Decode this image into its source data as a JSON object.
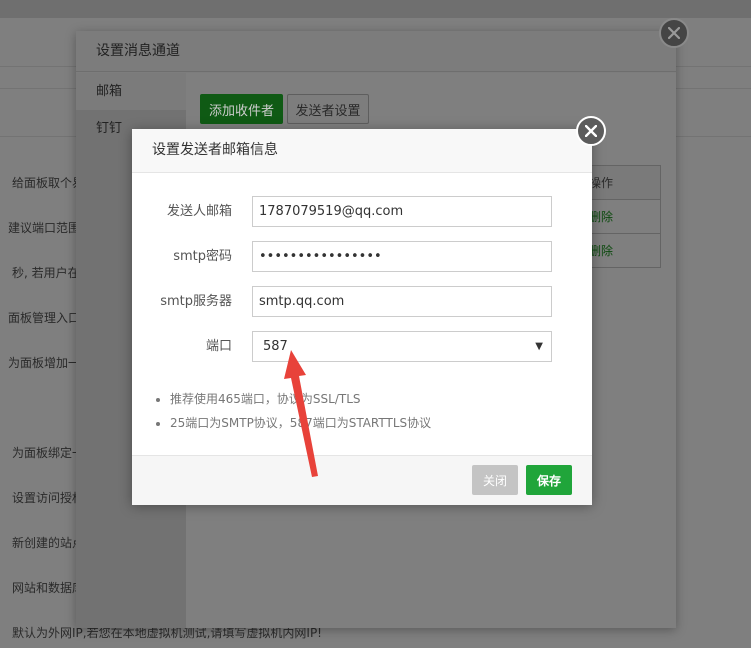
{
  "background": {
    "lines": [
      "给面板取个易",
      "建议端口范围",
      "秒, 若用户在",
      "面板管理入口",
      "为面板增加一",
      "为面板绑定一",
      "设置访问授权",
      "新创建的站点",
      "网站和数据库",
      "默认为外网IP,若您在本地虚拟机测试,请填写虚拟机内网IP!"
    ]
  },
  "outer_dialog": {
    "title": "设置消息通道",
    "side_items": [
      "邮箱",
      "钉钉"
    ],
    "add_button": "添加收件者",
    "sender_button": "发送者设置",
    "table": {
      "header": "操作",
      "rows": [
        "删除",
        "删除"
      ]
    }
  },
  "modal": {
    "title": "设置发送者邮箱信息",
    "fields": {
      "email": {
        "label": "发送人邮箱",
        "value": "1787079519@qq.com"
      },
      "password": {
        "label": "smtp密码",
        "value": "••••••••••••••••"
      },
      "server": {
        "label": "smtp服务器",
        "value": "smtp.qq.com"
      },
      "port": {
        "label": "端口",
        "value": "587"
      }
    },
    "tips": [
      "推荐使用465端口，协议为SSL/TLS",
      "25端口为SMTP协议，587端口为STARTTLS协议"
    ],
    "close_button": "关闭",
    "save_button": "保存"
  },
  "colors": {
    "primary_green": "#20a53a",
    "annotation_red": "#e8423a"
  }
}
